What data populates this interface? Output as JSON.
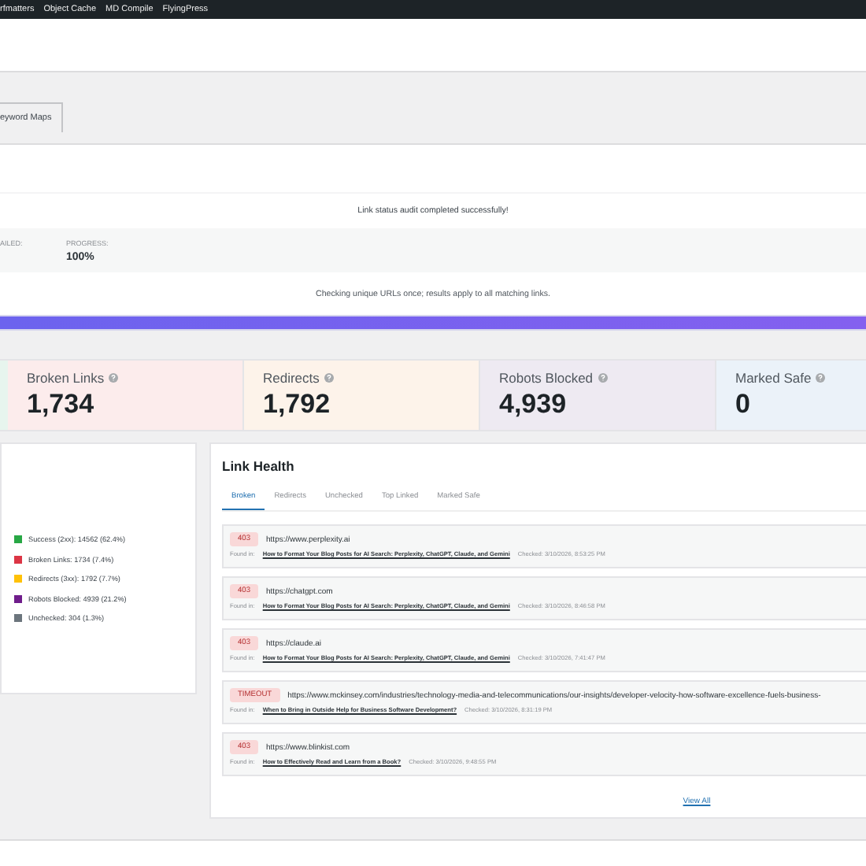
{
  "admin_bar": {
    "items": [
      "rfmatters",
      "Object Cache",
      "MD Compile",
      "FlyingPress"
    ]
  },
  "tabs": [
    {
      "label": "eyword Maps",
      "selected": false
    }
  ],
  "audit": {
    "message": "Link status audit completed successfully!",
    "stats": [
      {
        "label": "AILED:"
      },
      {
        "label": "PROGRESS:",
        "value": "100%"
      }
    ],
    "note": "Checking unique URLs once; results apply to all matching links.",
    "progress": {
      "level": 1
    }
  },
  "summary_cards": [
    {
      "color": "#e7f5ee"
    },
    {
      "label": "Broken Links",
      "value": "1,734",
      "color": "#fcecec"
    },
    {
      "label": "Redirects",
      "value": "1,792",
      "color": "#fdf3ea"
    },
    {
      "label": "Robots Blocked",
      "value": "4,939",
      "color": "#eeeaf2"
    },
    {
      "label": "Marked Safe",
      "value": "0",
      "color": "#ebf2f9"
    }
  ],
  "legend": [
    {
      "label": "Success (2xx): 14562 (62.4%)",
      "color": "#28a745"
    },
    {
      "label": "Broken Links: 1734 (7.4%)",
      "color": "#dc3545"
    },
    {
      "label": "Redirects (3xx): 1792 (7.7%)",
      "color": "#ffc107"
    },
    {
      "label": "Robots Blocked: 4939 (21.2%)",
      "color": "#6f1d8b"
    },
    {
      "label": "Unchecked: 304 (1.3%)",
      "color": "#6c757d"
    }
  ],
  "link_health": {
    "title": "Link Health",
    "tabs": [
      {
        "label": "Broken",
        "selected": true
      },
      {
        "label": "Redirects",
        "selected": false
      },
      {
        "label": "Unchecked",
        "selected": false
      },
      {
        "label": "Top Linked",
        "selected": false
      },
      {
        "label": "Marked Safe",
        "selected": false
      }
    ],
    "items": [
      {
        "code": "403",
        "url": "https://www.perplexity.ai",
        "found_label": "Found in:",
        "post": "How to Format Your Blog Posts for AI Search: Perplexity, ChatGPT, Claude, and Gemini",
        "checked": "Checked: 3/10/2026, 8:53:25 PM"
      },
      {
        "code": "403",
        "url": "https://chatgpt.com",
        "found_label": "Found in:",
        "post": "How to Format Your Blog Posts for AI Search: Perplexity, ChatGPT, Claude, and Gemini",
        "checked": "Checked: 3/10/2026, 8:46:58 PM"
      },
      {
        "code": "403",
        "url": "https://claude.ai",
        "found_label": "Found in:",
        "post": "How to Format Your Blog Posts for AI Search: Perplexity, ChatGPT, Claude, and Gemini",
        "checked": "Checked: 3/10/2026, 7:41:47 PM"
      },
      {
        "code": "TIMEOUT",
        "url": "https://www.mckinsey.com/industries/technology-media-and-telecommunications/our-insights/developer-velocity-how-software-excellence-fuels-business-",
        "found_label": "Found in:",
        "post": "When to Bring in Outside Help for Business Software Development?",
        "checked": "Checked: 3/10/2026, 8:31:19 PM"
      },
      {
        "code": "403",
        "url": "https://www.blinkist.com",
        "found_label": "Found in:",
        "post": "How to Effectively Read and Learn from a Book?",
        "checked": "Checked: 3/10/2026, 9:48:55 PM"
      }
    ],
    "view_all": "View All"
  }
}
